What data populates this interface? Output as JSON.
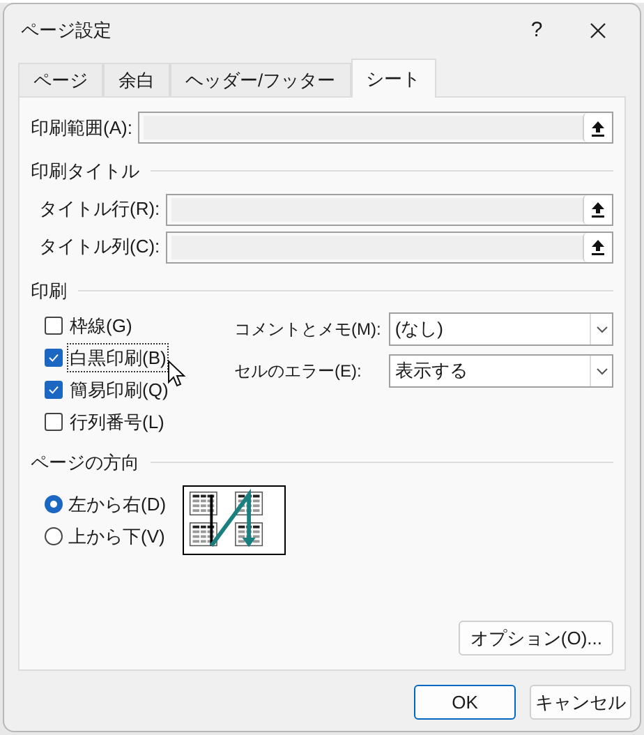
{
  "window": {
    "title": "ページ設定",
    "help": "?"
  },
  "tabs": [
    {
      "label": "ページ",
      "selected": false
    },
    {
      "label": "余白",
      "selected": false
    },
    {
      "label": "ヘッダー/フッター",
      "selected": false
    },
    {
      "label": "シート",
      "selected": true
    }
  ],
  "print_area": {
    "label": "印刷範囲(A):"
  },
  "print_titles": {
    "heading": "印刷タイトル",
    "fields": [
      {
        "label": "タイトル行(R):"
      },
      {
        "label": "タイトル列(C):"
      }
    ]
  },
  "print": {
    "heading": "印刷",
    "options": [
      {
        "label": "枠線(G)",
        "checked": false,
        "focused": false
      },
      {
        "label": "白黒印刷(B)",
        "checked": true,
        "focused": true
      },
      {
        "label": "簡易印刷(Q)",
        "checked": true,
        "focused": false
      },
      {
        "label": "行列番号(L)",
        "checked": false,
        "focused": false
      }
    ],
    "dropdowns": [
      {
        "label": "コメントとメモ(M):",
        "value": "(なし)"
      },
      {
        "label": "セルのエラー(E):",
        "value": "表示する"
      }
    ]
  },
  "page_order": {
    "heading": "ページの方向",
    "options": [
      {
        "label": "左から右(D)",
        "selected": true
      },
      {
        "label": "上から下(V)",
        "selected": false
      }
    ]
  },
  "options_button": "オプション(O)...",
  "buttons": [
    {
      "label": "OK",
      "default": true
    },
    {
      "label": "キャンセル",
      "default": false
    }
  ]
}
